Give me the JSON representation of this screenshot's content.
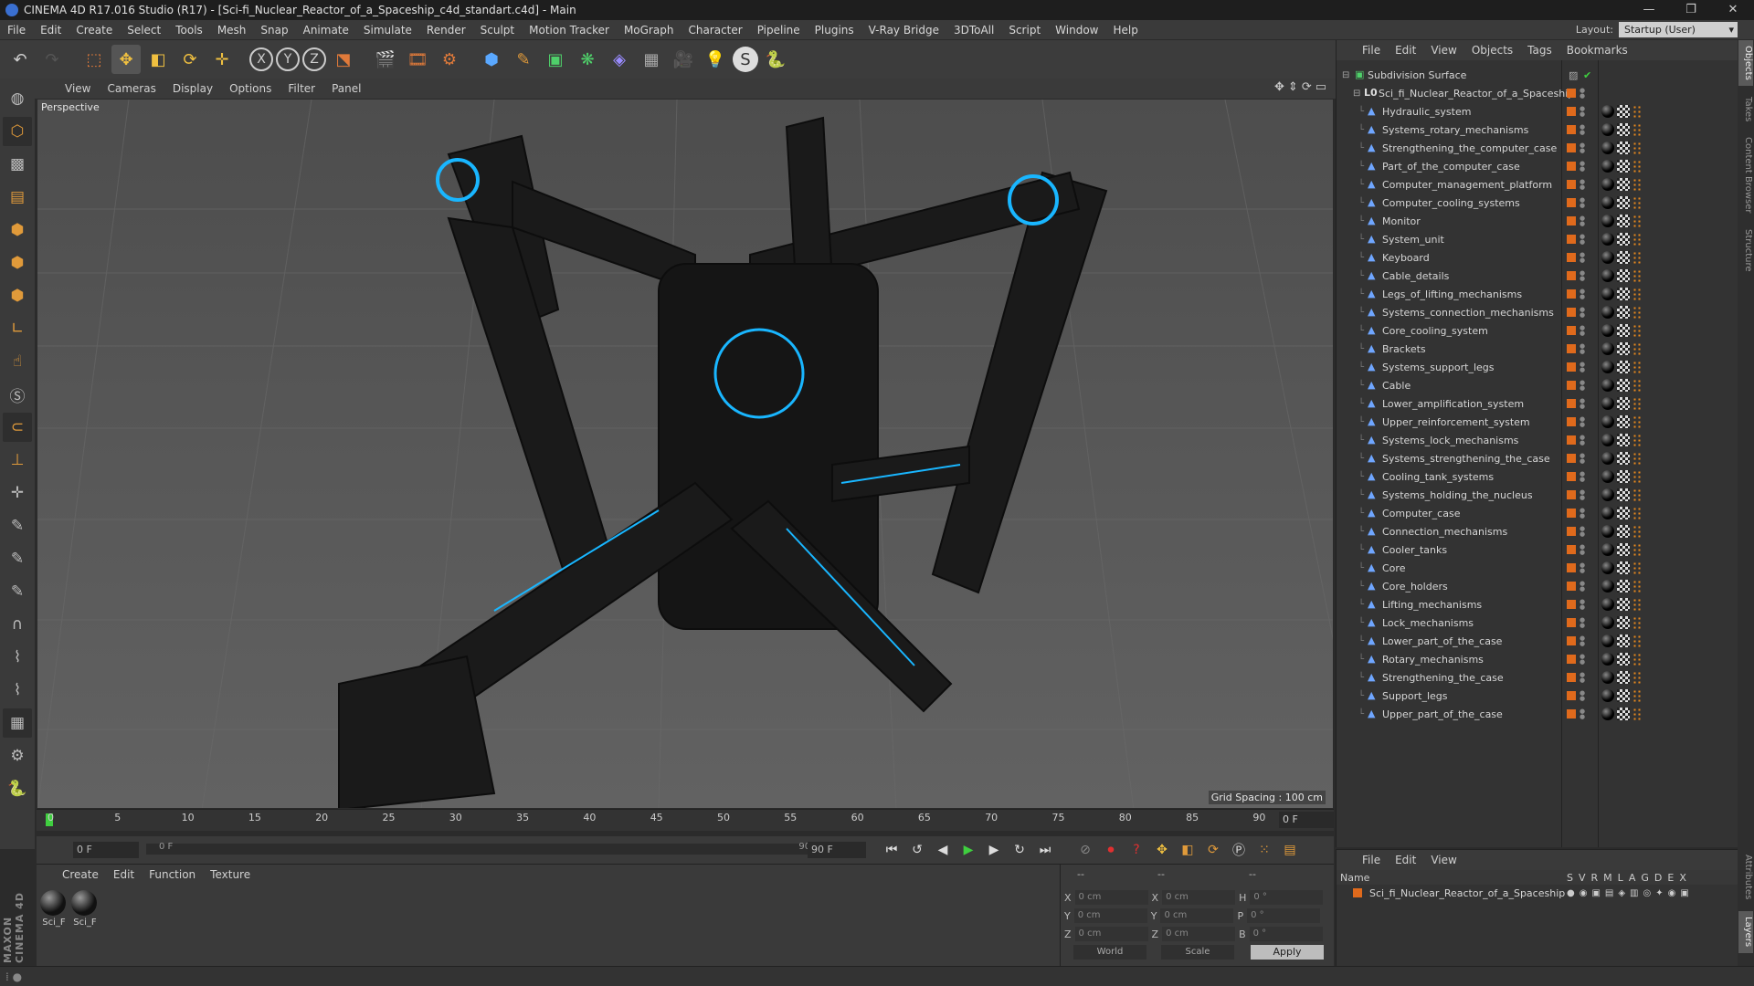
{
  "window": {
    "title": "CINEMA 4D R17.016 Studio (R17) - [Sci-fi_Nuclear_Reactor_of_a_Spaceship_c4d_standart.c4d] - Main",
    "controls": [
      "—",
      "❐",
      "✕"
    ]
  },
  "menubar": [
    "File",
    "Edit",
    "Create",
    "Select",
    "Tools",
    "Mesh",
    "Snap",
    "Animate",
    "Simulate",
    "Render",
    "Sculpt",
    "Motion Tracker",
    "MoGraph",
    "Character",
    "Pipeline",
    "Plugins",
    "V-Ray Bridge",
    "3DToAll",
    "Script",
    "Window",
    "Help"
  ],
  "layout": {
    "label": "Layout:",
    "value": "Startup (User)"
  },
  "viewport": {
    "menu": [
      "View",
      "Cameras",
      "Display",
      "Options",
      "Filter",
      "Panel"
    ],
    "label": "Perspective",
    "grid_spacing": "Grid Spacing : 100 cm"
  },
  "timeline": {
    "ticks": [
      "0",
      "5",
      "10",
      "15",
      "20",
      "25",
      "30",
      "35",
      "40",
      "45",
      "50",
      "55",
      "60",
      "65",
      "70",
      "75",
      "80",
      "85",
      "90"
    ],
    "frame_right": "0 F",
    "start": "0 F",
    "slider_left": "0 F",
    "slider_right": "90 F",
    "end": "90 F"
  },
  "material_manager": {
    "menu": [
      "Create",
      "Edit",
      "Function",
      "Texture"
    ],
    "materials": [
      "Sci_F",
      "Sci_F"
    ]
  },
  "coords": {
    "header": [
      "--",
      "--",
      "--"
    ],
    "rows": [
      {
        "a": "X",
        "v1": "0 cm",
        "b": "X",
        "v2": "0 cm",
        "c": "H",
        "v3": "0 °"
      },
      {
        "a": "Y",
        "v1": "0 cm",
        "b": "Y",
        "v2": "0 cm",
        "c": "P",
        "v3": "0 °"
      },
      {
        "a": "Z",
        "v1": "0 cm",
        "b": "Z",
        "v2": "0 cm",
        "c": "B",
        "v3": "0 °"
      }
    ],
    "world": "World",
    "scale": "Scale",
    "apply": "Apply"
  },
  "object_manager": {
    "menu": [
      "File",
      "Edit",
      "View",
      "Objects",
      "Tags",
      "Bookmarks"
    ],
    "root": "Subdivision Surface",
    "group": "Sci_fi_Nuclear_Reactor_of_a_Spaceship",
    "items": [
      "Hydraulic_system",
      "Systems_rotary_mechanisms",
      "Strengthening_the_computer_case",
      "Part_of_the_computer_case",
      "Computer_management_platform",
      "Computer_cooling_systems",
      "Monitor",
      "System_unit",
      "Keyboard",
      "Cable_details",
      "Legs_of_lifting_mechanisms",
      "Systems_connection_mechanisms",
      "Core_cooling_system",
      "Brackets",
      "Systems_support_legs",
      "Cable",
      "Lower_amplification_system",
      "Upper_reinforcement_system",
      "Systems_lock_mechanisms",
      "Systems_strengthening_the_case",
      "Cooling_tank_systems",
      "Systems_holding_the_nucleus",
      "Computer_case",
      "Connection_mechanisms",
      "Cooler_tanks",
      "Core",
      "Core_holders",
      "Lifting_mechanisms",
      "Lock_mechanisms",
      "Lower_part_of_the_case",
      "Rotary_mechanisms",
      "Strengthening_the_case",
      "Support_legs",
      "Upper_part_of_the_case"
    ]
  },
  "layer_manager": {
    "menu": [
      "File",
      "Edit",
      "View"
    ],
    "header": "Name",
    "cols": [
      "S",
      "V",
      "R",
      "M",
      "L",
      "A",
      "G",
      "D",
      "E",
      "X"
    ],
    "layer": "Sci_fi_Nuclear_Reactor_of_a_Spaceship"
  },
  "sidetabs": [
    "Objects",
    "Takes",
    "Content Browser",
    "Structure",
    "Attributes",
    "Layers"
  ],
  "colors": {
    "accent": "#e06a1c",
    "play": "#3fcf3f",
    "highlight": "#6fa6ff"
  }
}
